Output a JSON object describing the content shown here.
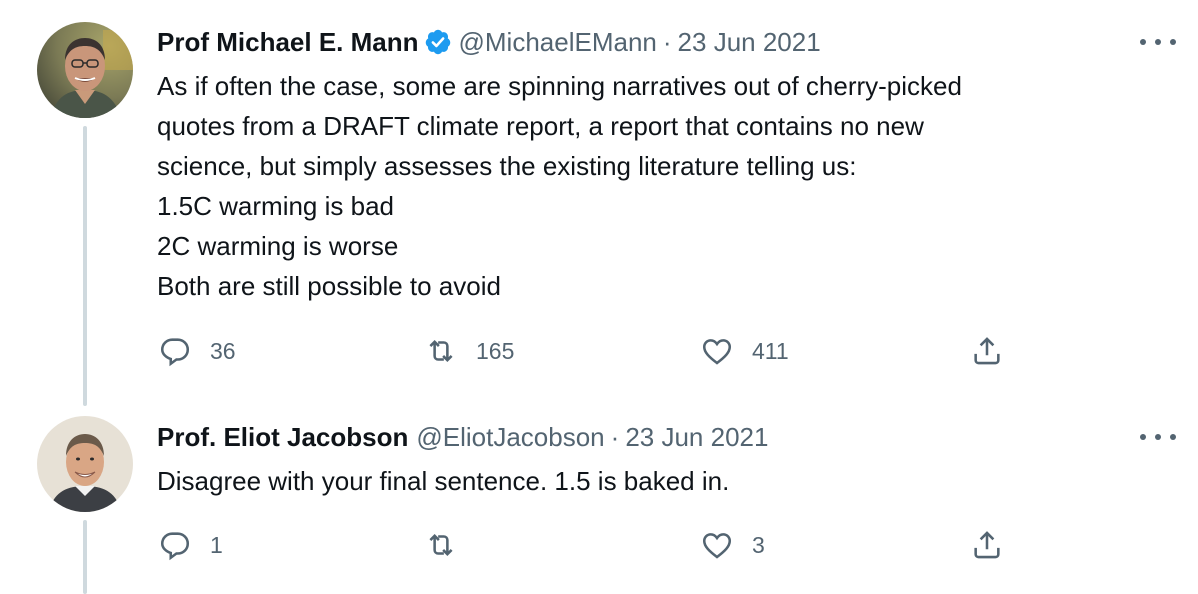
{
  "tweets": [
    {
      "author_name": "Prof Michael E. Mann",
      "verified": true,
      "handle": "@MichaelEMann",
      "separator": "·",
      "date": "23 Jun 2021",
      "text_lines": [
        "As if often the case, some are spinning narratives out of cherry-picked",
        "quotes from a DRAFT climate report, a report that contains no new",
        "science, but simply assesses the existing literature telling us:",
        "1.5C warming is bad",
        "2C warming is worse",
        "Both are still possible to avoid"
      ],
      "reply_count": "36",
      "retweet_count": "165",
      "like_count": "411"
    },
    {
      "author_name": "Prof. Eliot Jacobson",
      "verified": false,
      "handle": "@EliotJacobson",
      "separator": "·",
      "date": "23 Jun 2021",
      "text_lines": [
        "Disagree with your final sentence. 1.5 is baked in."
      ],
      "reply_count": "1",
      "retweet_count": "",
      "like_count": "3"
    }
  ],
  "icons": {
    "reply": "reply-icon",
    "retweet": "retweet-icon",
    "like": "heart-icon",
    "share": "share-icon",
    "more": "more-icon",
    "verified": "verified-badge-icon"
  },
  "colors": {
    "text": "#0f1419",
    "secondary": "#536471",
    "verified": "#1d9bf0",
    "thread_line": "#cfd9de"
  }
}
